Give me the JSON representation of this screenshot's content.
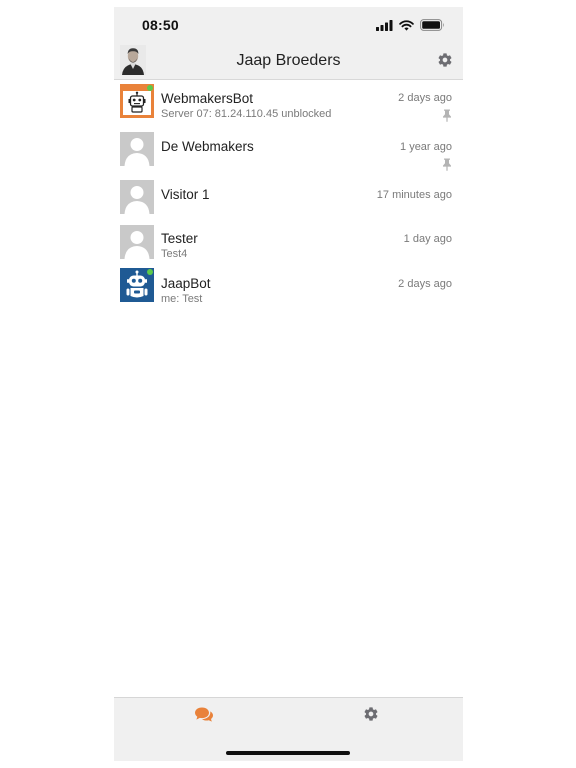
{
  "status_bar": {
    "time": "08:50",
    "icons": [
      "cellular-signal-icon",
      "wifi-icon",
      "battery-icon"
    ]
  },
  "header": {
    "title": "Jaap Broeders",
    "avatar_icon": "user-photo",
    "settings_icon": "gear-icon"
  },
  "chats": [
    {
      "name": "WebmakersBot",
      "preview": "Server 07: 81.24.110.45 unblocked",
      "time": "2 days ago",
      "pinned": true,
      "online": true,
      "avatar": "robot-orange"
    },
    {
      "name": "De Webmakers",
      "preview": "",
      "time": "1 year ago",
      "pinned": true,
      "online": false,
      "avatar": "placeholder-person"
    },
    {
      "name": "Visitor 1",
      "preview": "",
      "time": "17 minutes ago",
      "pinned": false,
      "online": false,
      "avatar": "placeholder-person"
    },
    {
      "name": "Tester",
      "preview": "Test4",
      "time": "1 day ago",
      "pinned": false,
      "online": false,
      "avatar": "placeholder-person"
    },
    {
      "name": "JaapBot",
      "preview": "me: Test",
      "time": "2 days ago",
      "pinned": false,
      "online": true,
      "avatar": "robot-blue"
    }
  ],
  "tab_bar": {
    "tabs": [
      {
        "icon": "chat-bubbles-icon",
        "active": true
      },
      {
        "icon": "gear-icon",
        "active": false
      }
    ]
  },
  "colors": {
    "accent": "#e9823a",
    "bar_background": "#f0f0f0",
    "online": "#5cc94a",
    "muted_text": "#7a7a7a",
    "icon_gray": "#6d6d72",
    "robot_blue": "#1f5a94"
  }
}
